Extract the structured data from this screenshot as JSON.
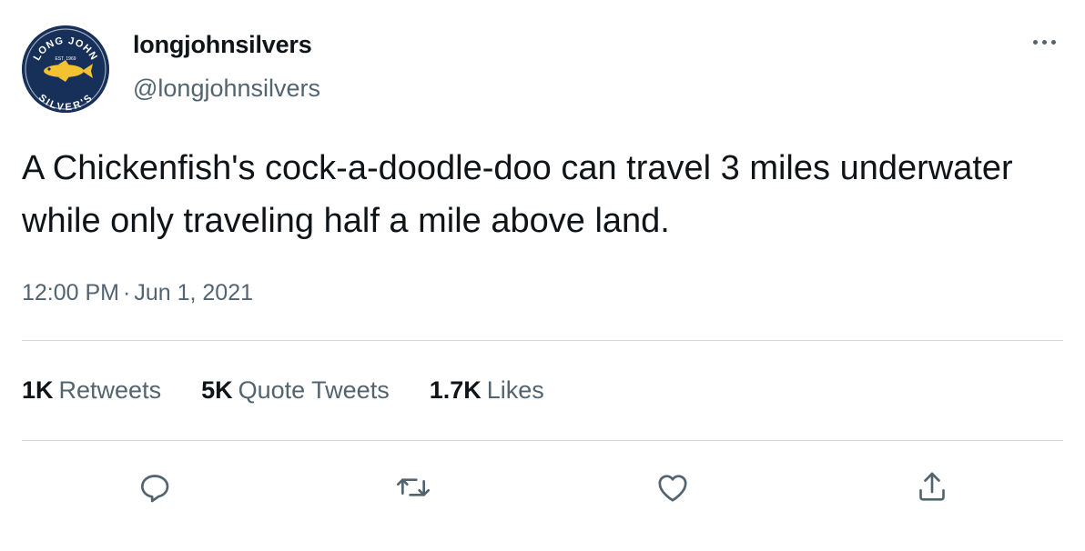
{
  "tweet": {
    "display_name": "longjohnsilvers",
    "handle": "@longjohnsilvers",
    "avatar": {
      "icon": "long-john-silvers-logo",
      "ring_top": "LONG JOHN",
      "ring_bottom": "SILVER'S",
      "est": "EST. 1969"
    },
    "text": "A Chickenfish's cock-a-doodle-doo can travel 3 miles underwater while only traveling half a mile above land.",
    "time": "12:00 PM",
    "separator": "·",
    "date": "Jun 1, 2021"
  },
  "stats": {
    "retweets": {
      "value": "1K",
      "label": "Retweets"
    },
    "quote_tweets": {
      "value": "5K",
      "label": "Quote Tweets"
    },
    "likes": {
      "value": "1.7K",
      "label": "Likes"
    }
  },
  "actions": [
    "reply-icon",
    "retweet-icon",
    "like-icon",
    "share-icon"
  ],
  "colors": {
    "text": "#0f1419",
    "secondary": "#536471",
    "divider": "#cfd9de",
    "avatar_bg": "#16305a",
    "avatar_fish": "#f2c230"
  }
}
